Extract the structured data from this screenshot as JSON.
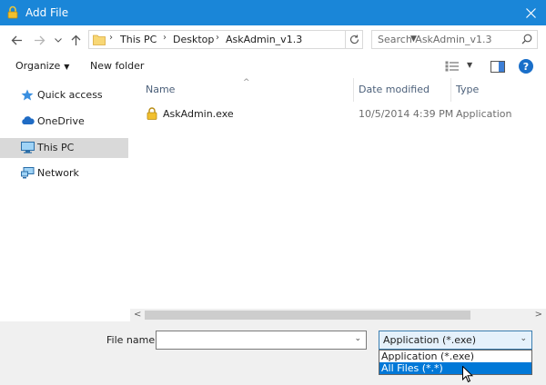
{
  "window": {
    "title": "Add File",
    "lock_icon": "lock-icon",
    "close_icon": "close-icon"
  },
  "nav": {
    "back_icon": "back-arrow-icon",
    "forward_icon": "forward-arrow-icon",
    "recent_icon": "chevron-down-icon",
    "up_icon": "up-arrow-icon"
  },
  "address": {
    "crumbs": [
      "This PC",
      "Desktop",
      "AskAdmin_v1.3"
    ],
    "separator": "›"
  },
  "search": {
    "placeholder": "Search AskAdmin_v1.3"
  },
  "toolbar": {
    "organize_label": "Organize",
    "new_folder_label": "New folder"
  },
  "sidebar": {
    "items": [
      {
        "label": "Quick access",
        "icon": "star-icon"
      },
      {
        "label": "OneDrive",
        "icon": "cloud-icon"
      },
      {
        "label": "This PC",
        "icon": "computer-icon",
        "selected": true
      },
      {
        "label": "Network",
        "icon": "network-icon"
      }
    ]
  },
  "columns": {
    "name": "Name",
    "date": "Date modified",
    "type": "Type"
  },
  "files": [
    {
      "name": "AskAdmin.exe",
      "date": "10/5/2014 4:39 PM",
      "type": "Application",
      "icon": "lock-app-icon"
    }
  ],
  "bottom": {
    "filename_label": "File name:",
    "filename_value": "",
    "filetype_selected": "Application (*.exe)",
    "filetype_options": [
      "Application (*.exe)",
      "All Files (*.*)"
    ],
    "highlighted_option_index": 1
  },
  "colors": {
    "titlebar": "#1a86d8",
    "selection": "#0078d7",
    "nav_selected": "#d9d9d9"
  }
}
